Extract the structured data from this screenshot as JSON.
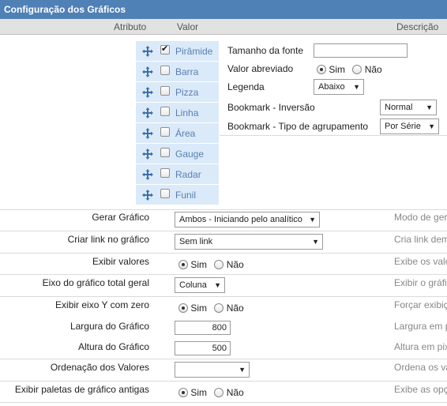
{
  "panel": {
    "title": "Configuração dos Gráficos"
  },
  "header": {
    "atributo": "Atributo",
    "valor": "Valor",
    "descricao": "Descrição"
  },
  "chart_types": [
    {
      "label": "Pirâmide",
      "checked": true,
      "icon": "move-icon"
    },
    {
      "label": "Barra",
      "checked": false,
      "icon": "move-icon"
    },
    {
      "label": "Pizza",
      "checked": false,
      "icon": "move-icon"
    },
    {
      "label": "Linha",
      "checked": false,
      "icon": "move-icon"
    },
    {
      "label": "Área",
      "checked": false,
      "icon": "move-icon"
    },
    {
      "label": "Gauge",
      "checked": false,
      "icon": "move-icon"
    },
    {
      "label": "Radar",
      "checked": false,
      "icon": "move-icon"
    },
    {
      "label": "Funil",
      "checked": false,
      "icon": "move-icon"
    }
  ],
  "chart_settings": {
    "font_size_label": "Tamanho da fonte",
    "font_size_value": "",
    "abbrev_label": "Valor abreviado",
    "abbrev_yes": "Sim",
    "abbrev_no": "Não",
    "abbrev_selected": "Sim",
    "legend_label": "Legenda",
    "legend_value": "Abaixo",
    "bookmark_inv_label": "Bookmark - Inversão",
    "bookmark_inv_value": "Normal",
    "bookmark_group_label": "Bookmark - Tipo de agrupamento",
    "bookmark_group_value": "Por Série"
  },
  "rows": {
    "gerar": {
      "label": "Gerar Gráfico",
      "value": "Ambos - Iniciando pelo analítico",
      "desc": "Modo de ger"
    },
    "link": {
      "label": "Criar link no gráfico",
      "value": "Sem link",
      "desc": "Cria link dem"
    },
    "exibir_valores": {
      "label": "Exibir valores",
      "yes": "Sim",
      "no": "Não",
      "selected": "Sim",
      "desc": "Exibe os valo"
    },
    "eixo": {
      "label": "Eixo do gráfico total geral",
      "value": "Coluna",
      "desc": "Exibir o gráfi"
    },
    "eixo_y": {
      "label": "Exibir eixo Y com zero",
      "yes": "Sim",
      "no": "Não",
      "selected": "Sim",
      "desc": "Forçar exibiç"
    },
    "largura": {
      "label": "Largura do Gráfico",
      "value": "800",
      "desc": "Largura em p"
    },
    "altura": {
      "label": "Altura do Gráfico",
      "value": "500",
      "desc": "Altura em pix"
    },
    "ordenacao": {
      "label": "Ordenação dos Valores",
      "value": "",
      "desc": "Ordena os va"
    },
    "paletas": {
      "label": "Exibir paletas de gráfico antigas",
      "yes": "Sim",
      "no": "Não",
      "selected": "Sim",
      "desc": "Exibe as opç"
    }
  },
  "colors": {
    "title_bg": "#4f80b6",
    "chart_type_bg": "#dbeaf9",
    "link_text": "#5a7fb0"
  }
}
